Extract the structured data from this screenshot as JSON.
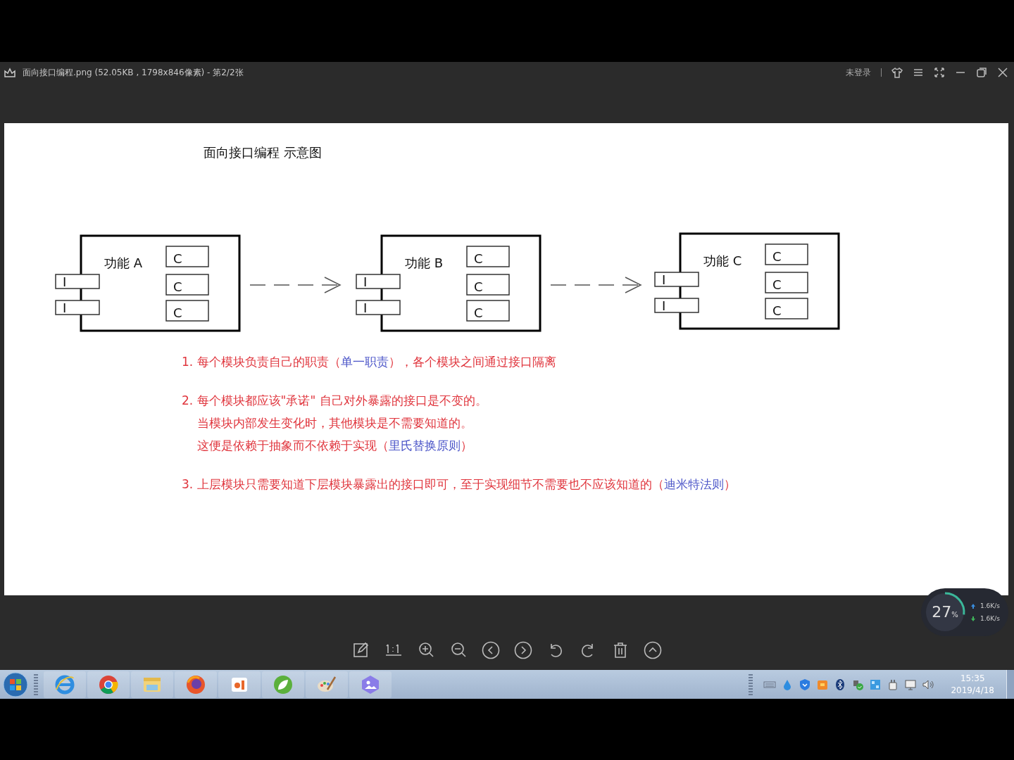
{
  "viewer": {
    "title": "面向接口编程.png (52.05KB , 1798x846像素) - 第2/2张",
    "login": "未登录"
  },
  "image": {
    "heading": "面向接口编程 示意图",
    "modules": [
      {
        "label": "功能 A",
        "interfaces": [
          "I",
          "I"
        ],
        "classes": [
          "C",
          "C",
          "C"
        ]
      },
      {
        "label": "功能 B",
        "interfaces": [
          "I",
          "I"
        ],
        "classes": [
          "C",
          "C",
          "C"
        ]
      },
      {
        "label": "功能 C",
        "interfaces": [
          "I",
          "I"
        ],
        "classes": [
          "C",
          "C",
          "C"
        ]
      }
    ],
    "notes": [
      {
        "lines": [
          [
            {
              "kind": "plain",
              "text": "1. 每个模块负责自己的职责（"
            },
            {
              "kind": "term",
              "text": "单一职责"
            },
            {
              "kind": "plain",
              "text": "），各个模块之间通过接口隔离"
            }
          ]
        ]
      },
      {
        "lines": [
          [
            {
              "kind": "plain",
              "text": "2. 每个模块都应该\"承诺\" 自己对外暴露的接口是不变的。"
            }
          ],
          [
            {
              "kind": "plain",
              "text": "当模块内部发生变化时，其他模块是不需要知道的。"
            }
          ],
          [
            {
              "kind": "plain",
              "text": "这便是依赖于抽象而不依赖于实现（"
            },
            {
              "kind": "term",
              "text": "里氏替换原则"
            },
            {
              "kind": "plain",
              "text": "）"
            }
          ]
        ]
      },
      {
        "lines": [
          [
            {
              "kind": "plain",
              "text": "3. 上层模块只需要知道下层模块暴露出的接口即可，至于实现细节不需要也不应该知道的（"
            },
            {
              "kind": "term",
              "text": "迪米特法则"
            },
            {
              "kind": "plain",
              "text": "）"
            }
          ]
        ]
      }
    ]
  },
  "speed": {
    "percent": "27",
    "unit": "%",
    "upload": "1.6K/s",
    "download": "1.6K/s"
  },
  "taskbar": {
    "time": "15:35",
    "date": "2019/4/18"
  }
}
